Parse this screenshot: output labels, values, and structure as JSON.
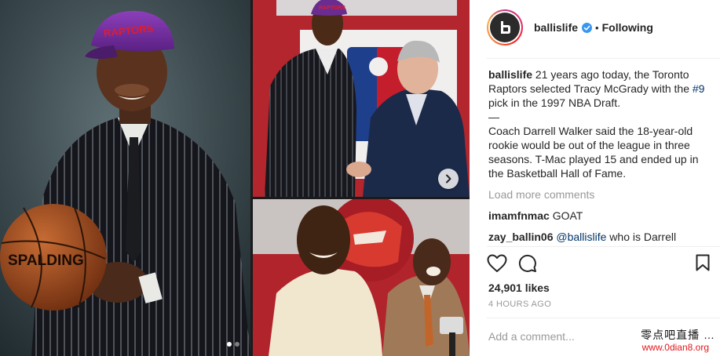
{
  "post": {
    "username": "ballislife",
    "separator": "•",
    "follow_status": "Following"
  },
  "caption": {
    "username": "ballislife",
    "text_before_tag": " 21 years ago today, the Toronto Raptors selected Tracy McGrady with the ",
    "hashtag": "#9",
    "text_after_tag": " pick in the 1997 NBA Draft.",
    "dash": "—",
    "paragraph2": "Coach Darrell Walker said the 18-year-old rookie would be out of the league in three seasons. T-Mac played 15 and ended up in the Basketball Hall of Fame."
  },
  "load_more_label": "Load more comments",
  "comments": [
    {
      "username": "imamfnmac",
      "text": " GOAT",
      "mention": ""
    },
    {
      "username": "zay_ballin06",
      "mention": "@ballislife",
      "text": " who is Darrell walker?"
    }
  ],
  "likes": "24,901 likes",
  "timestamp": "4 HOURS AGO",
  "add_comment_placeholder": "Add a comment...",
  "more_label": "…",
  "watermark": {
    "line1": "零点吧直播",
    "line2": "www.0dian8.org"
  },
  "photo_text": {
    "cap_logo": "RAPTORS",
    "ball_brand": "SPALDING"
  },
  "carousel": {
    "total": 2,
    "current": 1
  },
  "colors": {
    "link": "#003569",
    "muted": "#999999",
    "verified": "#3897f0",
    "watermark_red": "#e3161c"
  }
}
